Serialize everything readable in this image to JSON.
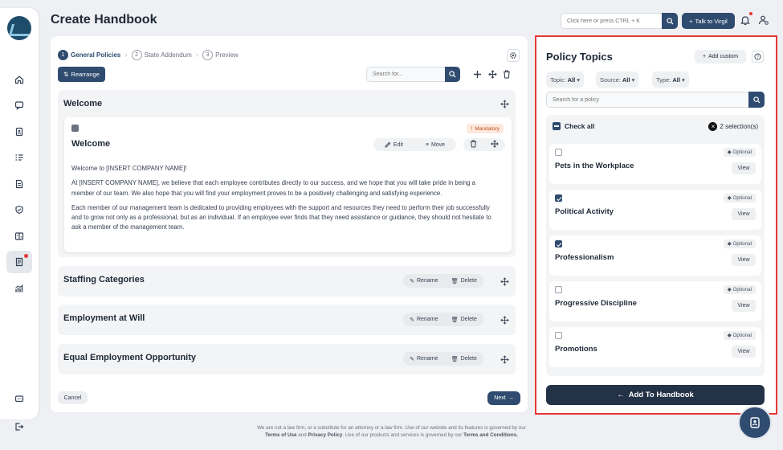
{
  "header": {
    "title": "Create Handbook",
    "search_placeholder": "Click here or press CTRL + K",
    "talk_button": "Talk to Virgil"
  },
  "steps": [
    {
      "num": "1",
      "label": "General Policies"
    },
    {
      "num": "2",
      "label": "State Addendum"
    },
    {
      "num": "3",
      "label": "Preview"
    }
  ],
  "toolbar": {
    "rearrange": "Rearrange",
    "search_placeholder": "Search for..."
  },
  "welcome_section": {
    "title": "Welcome",
    "card": {
      "badge": "Mandatory",
      "title": "Welcome",
      "edit": "Edit",
      "move": "Move",
      "paragraphs": [
        "Welcome to [INSERT COMPANY NAME]!",
        "At [INSERT COMPANY NAME], we believe that each employee contributes directly to our success, and we hope that you will take pride in being a member of our team. We also hope that you will find your employment proves to be a positively challenging and satisfying experience.",
        "Each member of our management team is dedicated to providing employees with the support and resources they need to perform their job successfully and to grow not only as a professional, but as an individual. If an employee ever finds that they need assistance or guidance, they should not hesitate to ask a member of the management team."
      ]
    }
  },
  "sections": [
    {
      "title": "Staffing Categories",
      "rename": "Rename",
      "delete": "Delete"
    },
    {
      "title": "Employment at Will",
      "rename": "Rename",
      "delete": "Delete"
    },
    {
      "title": "Equal Employment Opportunity",
      "rename": "Rename",
      "delete": "Delete"
    }
  ],
  "footer_buttons": {
    "cancel": "Cancel",
    "next": "Next"
  },
  "footer": {
    "line1": "We are not a law firm, or a substitute for an attorney or a law firm. Use of our website and its features is governed by our",
    "terms_of_use": "Terms of Use",
    "and": "and",
    "privacy": "Privacy Policy",
    "line2_mid": ". Use of our products and services is governed by our",
    "terms_conditions": "Terms and Conditions."
  },
  "panel": {
    "title": "Policy Topics",
    "add_custom": "Add custom",
    "filters": [
      {
        "label": "Topic:",
        "value": "All"
      },
      {
        "label": "Source:",
        "value": "All"
      },
      {
        "label": "Type:",
        "value": "All"
      }
    ],
    "search_placeholder": "Search for a policy",
    "check_all": "Check all",
    "selections": "2 selection(s)",
    "items": [
      {
        "name": "Pets in the Workplace",
        "tag": "Optional",
        "view": "View",
        "checked": false
      },
      {
        "name": "Political Activity",
        "tag": "Optional",
        "view": "View",
        "checked": true
      },
      {
        "name": "Professionalism",
        "tag": "Optional",
        "view": "View",
        "checked": true
      },
      {
        "name": "Progressive Discipline",
        "tag": "Optional",
        "view": "View",
        "checked": false
      },
      {
        "name": "Promotions",
        "tag": "Optional",
        "view": "View",
        "checked": false
      }
    ],
    "add_button": "Add To Handbook"
  },
  "colors": {
    "primary": "#2f4b6f",
    "highlight_border": "#e53935",
    "mandatory": "#c0501f"
  }
}
